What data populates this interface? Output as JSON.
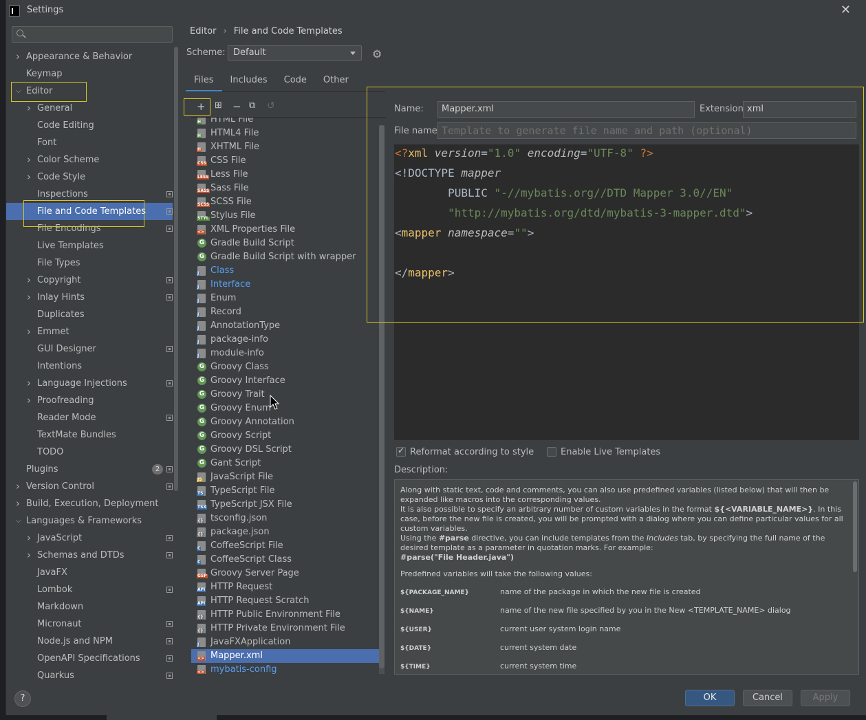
{
  "window": {
    "title": "Settings"
  },
  "sidebar": {
    "items": [
      {
        "label": "Appearance & Behavior",
        "level": 0,
        "chevron": "right"
      },
      {
        "label": "Keymap",
        "level": 0,
        "chevron": ""
      },
      {
        "label": "Editor",
        "level": 0,
        "chevron": "down"
      },
      {
        "label": "General",
        "level": 1,
        "chevron": "right"
      },
      {
        "label": "Code Editing",
        "level": 1,
        "chevron": ""
      },
      {
        "label": "Font",
        "level": 1,
        "chevron": ""
      },
      {
        "label": "Color Scheme",
        "level": 1,
        "chevron": "right"
      },
      {
        "label": "Code Style",
        "level": 1,
        "chevron": "right"
      },
      {
        "label": "Inspections",
        "level": 1,
        "chevron": "",
        "project": true
      },
      {
        "label": "File and Code Templates",
        "level": 1,
        "chevron": "",
        "project": true,
        "selected": true
      },
      {
        "label": "File Encodings",
        "level": 1,
        "chevron": "",
        "project": true
      },
      {
        "label": "Live Templates",
        "level": 1,
        "chevron": ""
      },
      {
        "label": "File Types",
        "level": 1,
        "chevron": ""
      },
      {
        "label": "Copyright",
        "level": 1,
        "chevron": "right",
        "project": true
      },
      {
        "label": "Inlay Hints",
        "level": 1,
        "chevron": "right",
        "project": true
      },
      {
        "label": "Duplicates",
        "level": 1,
        "chevron": ""
      },
      {
        "label": "Emmet",
        "level": 1,
        "chevron": "right"
      },
      {
        "label": "GUI Designer",
        "level": 1,
        "chevron": "",
        "project": true
      },
      {
        "label": "Intentions",
        "level": 1,
        "chevron": ""
      },
      {
        "label": "Language Injections",
        "level": 1,
        "chevron": "right",
        "project": true
      },
      {
        "label": "Proofreading",
        "level": 1,
        "chevron": "right"
      },
      {
        "label": "Reader Mode",
        "level": 1,
        "chevron": "",
        "project": true
      },
      {
        "label": "TextMate Bundles",
        "level": 1,
        "chevron": ""
      },
      {
        "label": "TODO",
        "level": 1,
        "chevron": ""
      },
      {
        "label": "Plugins",
        "level": 0,
        "chevron": "",
        "project": true,
        "badge": "2"
      },
      {
        "label": "Version Control",
        "level": 0,
        "chevron": "right",
        "project": true
      },
      {
        "label": "Build, Execution, Deployment",
        "level": 0,
        "chevron": "right"
      },
      {
        "label": "Languages & Frameworks",
        "level": 0,
        "chevron": "down"
      },
      {
        "label": "JavaScript",
        "level": 1,
        "chevron": "right",
        "project": true
      },
      {
        "label": "Schemas and DTDs",
        "level": 1,
        "chevron": "right",
        "project": true
      },
      {
        "label": "JavaFX",
        "level": 1,
        "chevron": ""
      },
      {
        "label": "Lombok",
        "level": 1,
        "chevron": "",
        "project": true
      },
      {
        "label": "Markdown",
        "level": 1,
        "chevron": ""
      },
      {
        "label": "Micronaut",
        "level": 1,
        "chevron": "",
        "project": true
      },
      {
        "label": "Node.js and NPM",
        "level": 1,
        "chevron": "",
        "project": true
      },
      {
        "label": "OpenAPI Specifications",
        "level": 1,
        "chevron": "",
        "project": true
      },
      {
        "label": "Quarkus",
        "level": 1,
        "chevron": "",
        "project": true
      }
    ]
  },
  "breadcrumb": {
    "parent": "Editor",
    "separator": "›",
    "current": "File and Code Templates"
  },
  "scheme": {
    "label": "Scheme:",
    "value": "Default"
  },
  "tabs": [
    "Files",
    "Includes",
    "Code",
    "Other"
  ],
  "templates": [
    {
      "name": "HTML File",
      "icon": "html-file-icon",
      "tag": "H",
      "color": "#4f8a3c"
    },
    {
      "name": "HTML4 File",
      "icon": "html-file-icon",
      "tag": "H",
      "color": "#4f8a3c"
    },
    {
      "name": "XHTML File",
      "icon": "xhtml-file-icon",
      "tag": "H",
      "color": "#c2502b"
    },
    {
      "name": "CSS File",
      "icon": "css-file-icon",
      "tag": "CSS",
      "color": "#c2502b"
    },
    {
      "name": "Less File",
      "icon": "less-file-icon",
      "tag": "LESS",
      "color": "#c2502b"
    },
    {
      "name": "Sass File",
      "icon": "sass-file-icon",
      "tag": "SASS",
      "color": "#c2502b"
    },
    {
      "name": "SCSS File",
      "icon": "scss-file-icon",
      "tag": "SCSS",
      "color": "#c2502b"
    },
    {
      "name": "Stylus File",
      "icon": "stylus-file-icon",
      "tag": "STYL",
      "color": "#4f8a3c"
    },
    {
      "name": "XML Properties File",
      "icon": "xml-file-icon",
      "tag": "<>",
      "color": "#c2502b"
    },
    {
      "name": "Gradle Build Script",
      "icon": "gradle-icon",
      "tag": "G",
      "color": "#629755",
      "round": true
    },
    {
      "name": "Gradle Build Script with wrapper",
      "icon": "gradle-icon",
      "tag": "G",
      "color": "#629755",
      "round": true
    },
    {
      "name": "Class",
      "icon": "java-file-icon",
      "tag": "J",
      "color": "#3d6ea8",
      "blue": true
    },
    {
      "name": "Interface",
      "icon": "java-file-icon",
      "tag": "J",
      "color": "#3d6ea8",
      "blue": true
    },
    {
      "name": "Enum",
      "icon": "java-file-icon",
      "tag": "J",
      "color": "#3d6ea8"
    },
    {
      "name": "Record",
      "icon": "java-file-icon",
      "tag": "J",
      "color": "#3d6ea8"
    },
    {
      "name": "AnnotationType",
      "icon": "java-file-icon",
      "tag": "J",
      "color": "#3d6ea8"
    },
    {
      "name": "package-info",
      "icon": "java-file-icon",
      "tag": "J",
      "color": "#3d6ea8"
    },
    {
      "name": "module-info",
      "icon": "java-file-icon",
      "tag": "J",
      "color": "#3d6ea8"
    },
    {
      "name": "Groovy Class",
      "icon": "groovy-icon",
      "tag": "G",
      "color": "#629755",
      "round": true
    },
    {
      "name": "Groovy Interface",
      "icon": "groovy-icon",
      "tag": "G",
      "color": "#629755",
      "round": true
    },
    {
      "name": "Groovy Trait",
      "icon": "groovy-icon",
      "tag": "G",
      "color": "#629755",
      "round": true
    },
    {
      "name": "Groovy Enum",
      "icon": "groovy-icon",
      "tag": "G",
      "color": "#629755",
      "round": true
    },
    {
      "name": "Groovy Annotation",
      "icon": "groovy-icon",
      "tag": "G",
      "color": "#629755",
      "round": true
    },
    {
      "name": "Groovy Script",
      "icon": "groovy-icon",
      "tag": "G",
      "color": "#629755",
      "round": true
    },
    {
      "name": "Groovy DSL Script",
      "icon": "groovy-icon",
      "tag": "G",
      "color": "#629755",
      "round": true
    },
    {
      "name": "Gant Script",
      "icon": "groovy-icon",
      "tag": "G",
      "color": "#629755",
      "round": true
    },
    {
      "name": "JavaScript File",
      "icon": "js-file-icon",
      "tag": "JS",
      "color": "#b7952a"
    },
    {
      "name": "TypeScript File",
      "icon": "ts-file-icon",
      "tag": "TS",
      "color": "#3d6ea8"
    },
    {
      "name": "TypeScript JSX File",
      "icon": "tsx-file-icon",
      "tag": "TSX",
      "color": "#3d6ea8"
    },
    {
      "name": "tsconfig.json",
      "icon": "config-file-icon",
      "tag": "{}",
      "color": "#777777"
    },
    {
      "name": "package.json",
      "icon": "json-file-icon",
      "tag": "{}",
      "color": "#777777"
    },
    {
      "name": "CoffeeScript File",
      "icon": "coffee-file-icon",
      "tag": "C",
      "color": "#3d6ea8"
    },
    {
      "name": "CoffeeScript Class",
      "icon": "coffee-file-icon",
      "tag": "C",
      "color": "#3d6ea8"
    },
    {
      "name": "Groovy Server Page",
      "icon": "gsp-file-icon",
      "tag": "GSP",
      "color": "#c2502b"
    },
    {
      "name": "HTTP Request",
      "icon": "http-file-icon",
      "tag": "API",
      "color": "#3d6ea8"
    },
    {
      "name": "HTTP Request Scratch",
      "icon": "http-file-icon",
      "tag": "API",
      "color": "#3d6ea8"
    },
    {
      "name": "HTTP Public Environment File",
      "icon": "env-file-icon",
      "tag": "{}",
      "color": "#777777"
    },
    {
      "name": "HTTP Private Environment File",
      "icon": "env-file-icon",
      "tag": "{}",
      "color": "#777777"
    },
    {
      "name": "JavaFXApplication",
      "icon": "java-file-icon",
      "tag": "J",
      "color": "#3d6ea8"
    },
    {
      "name": "Mapper.xml",
      "icon": "xml-file-icon",
      "tag": "<>",
      "color": "#c2502b",
      "selected": true
    },
    {
      "name": "mybatis-config",
      "icon": "xml-file-icon",
      "tag": "<>",
      "color": "#c2502b",
      "blue": true
    }
  ],
  "editor": {
    "name_label": "Name:",
    "name_value": "Mapper.xml",
    "extension_label": "Extension:",
    "extension_value": "xml",
    "filename_label": "File name:",
    "filename_placeholder": "Template to generate file name and path (optional)",
    "code": {
      "l1_a": "<?",
      "l1_b": "xml ",
      "l1_c": "version",
      "l1_d": "=",
      "l1_e": "\"1.0\"",
      "l1_f": " ",
      "l1_g": "encoding",
      "l1_h": "=",
      "l1_i": "\"UTF-8\"",
      "l1_j": " ?>",
      "l2_a": "<!DOCTYPE ",
      "l2_b": "mapper",
      "l3_a": "        PUBLIC ",
      "l3_b": "\"-//mybatis.org//DTD Mapper 3.0//EN\"",
      "l4_a": "        ",
      "l4_b": "\"http://mybatis.org/dtd/mybatis-3-mapper.dtd\"",
      "l4_c": ">",
      "l5_a": "<",
      "l5_b": "mapper ",
      "l5_c": "namespace",
      "l5_d": "=",
      "l5_e": "\"\"",
      "l5_f": ">",
      "l7_a": "</",
      "l7_b": "mapper",
      "l7_c": ">"
    },
    "reformat_label": "Reformat according to style",
    "reformat_checked": true,
    "live_templates_label": "Enable Live Templates",
    "live_templates_checked": false,
    "description_label": "Description:"
  },
  "description": {
    "p1": "Along with static text, code and comments, you can also use predefined variables (listed below) that will then be expanded like macros into the corresponding values.",
    "p2a": "It is also possible to specify an arbitrary number of custom variables in the format ",
    "p2b": "${<VARIABLE_NAME>}",
    "p2c": ". In this case, before the new file is created, you will be prompted with a dialog where you can define particular values for all custom variables.",
    "p3a": "Using the ",
    "p3b": "#parse",
    "p3c": " directive, you can include templates from the ",
    "p3d": "Includes",
    "p3e": " tab, by specifying the full name of the desired template as a parameter in quotation marks. For example:",
    "p4": "#parse(\"File Header.java\")",
    "p5": "Predefined variables will take the following values:",
    "vars": [
      {
        "name": "${PACKAGE_NAME}",
        "value": "name of the package in which the new file is created"
      },
      {
        "name": "${NAME}",
        "value": "name of the new file specified by you in the New <TEMPLATE_NAME> dialog"
      },
      {
        "name": "${USER}",
        "value": "current user system login name"
      },
      {
        "name": "${DATE}",
        "value": "current system date"
      },
      {
        "name": "${TIME}",
        "value": "current system time"
      }
    ]
  },
  "buttons": {
    "help": "?",
    "ok": "OK",
    "cancel": "Cancel",
    "apply": "Apply"
  },
  "colors": {
    "accent": "#4b6eaf",
    "highlight_box": "#d9c525",
    "primary_button": "#365880"
  }
}
